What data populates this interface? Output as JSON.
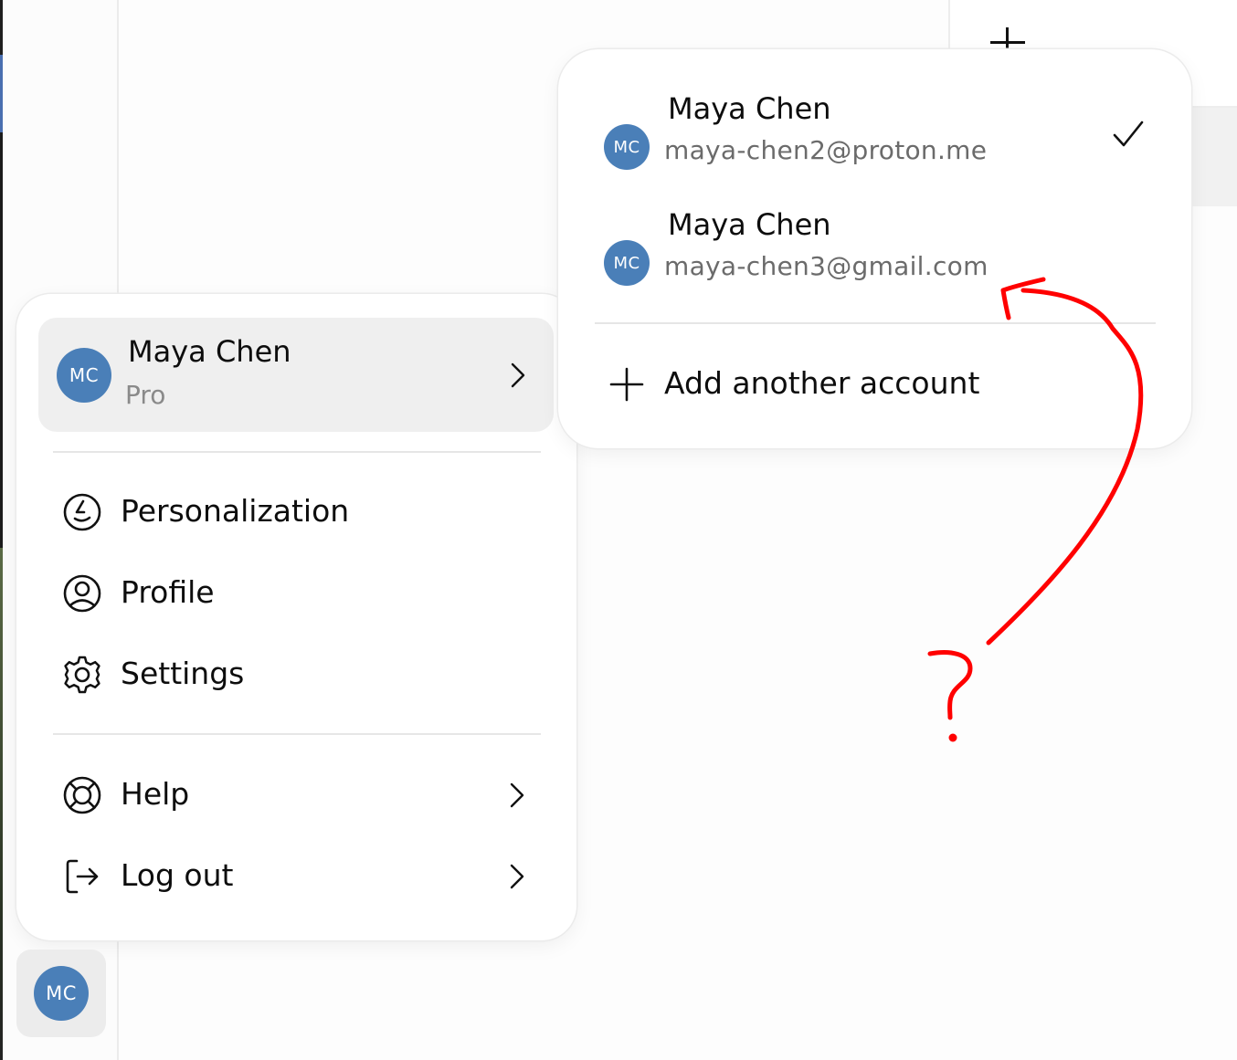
{
  "user": {
    "initials": "MC",
    "name": "Maya Chen",
    "plan": "Pro"
  },
  "menu": {
    "items": [
      {
        "label": "Personalization",
        "icon": "personalization-icon"
      },
      {
        "label": "Profile",
        "icon": "profile-icon"
      },
      {
        "label": "Settings",
        "icon": "gear-icon"
      },
      {
        "label": "Help",
        "icon": "lifebuoy-icon"
      },
      {
        "label": "Log out",
        "icon": "logout-icon"
      }
    ]
  },
  "accounts": {
    "list": [
      {
        "initials": "MC",
        "name": "Maya Chen",
        "email": "maya-chen2@proton.me",
        "selected": true
      },
      {
        "initials": "MC",
        "name": "Maya Chen",
        "email": "maya-chen3@gmail.com",
        "selected": false
      }
    ],
    "add_label": "Add another account"
  },
  "colors": {
    "avatar": "#4a7fb8",
    "annotation": "#ff0000"
  }
}
